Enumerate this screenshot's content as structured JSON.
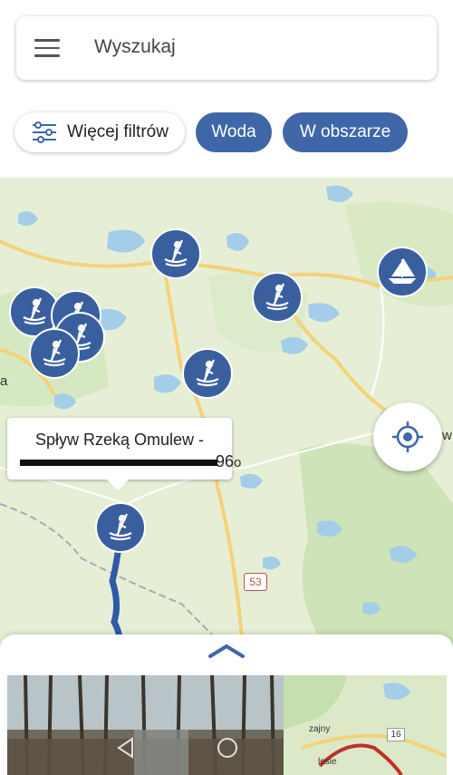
{
  "search": {
    "placeholder": "Wyszukaj"
  },
  "filters": {
    "more_label": "Więcej filtrów",
    "chip_water": "Woda",
    "chip_area": "W obszarze"
  },
  "map": {
    "road_number": "53",
    "edge_label_left": "a",
    "edge_label_right": "w",
    "tooltip": {
      "title": "Spływ Rzeką Omulew -",
      "subtitle_visible_end": "96",
      "subtitle_suffix": "o"
    },
    "markers": [
      {
        "name": "kayak-marker-1",
        "icon": "kayak-icon"
      },
      {
        "name": "kayak-marker-2",
        "icon": "kayak-icon"
      },
      {
        "name": "kayak-marker-3",
        "icon": "kayak-icon"
      },
      {
        "name": "kayak-marker-4",
        "icon": "kayak-icon"
      },
      {
        "name": "kayak-marker-5",
        "icon": "kayak-icon"
      },
      {
        "name": "kayak-marker-6",
        "icon": "kayak-icon"
      },
      {
        "name": "kayak-marker-7",
        "icon": "kayak-icon"
      },
      {
        "name": "kayak-marker-selected",
        "icon": "kayak-icon"
      },
      {
        "name": "sailboat-marker",
        "icon": "sailboat-icon"
      }
    ]
  },
  "bottom_sheet": {
    "mini_map_road": "16",
    "mini_map_label_1": "zajny",
    "mini_map_label_2": "lesie"
  },
  "colors": {
    "accent": "#3f67a8",
    "marker": "#3a5f9e",
    "water": "#a3cde8",
    "land": "#e6efd6",
    "route": "#2e5aa8"
  }
}
